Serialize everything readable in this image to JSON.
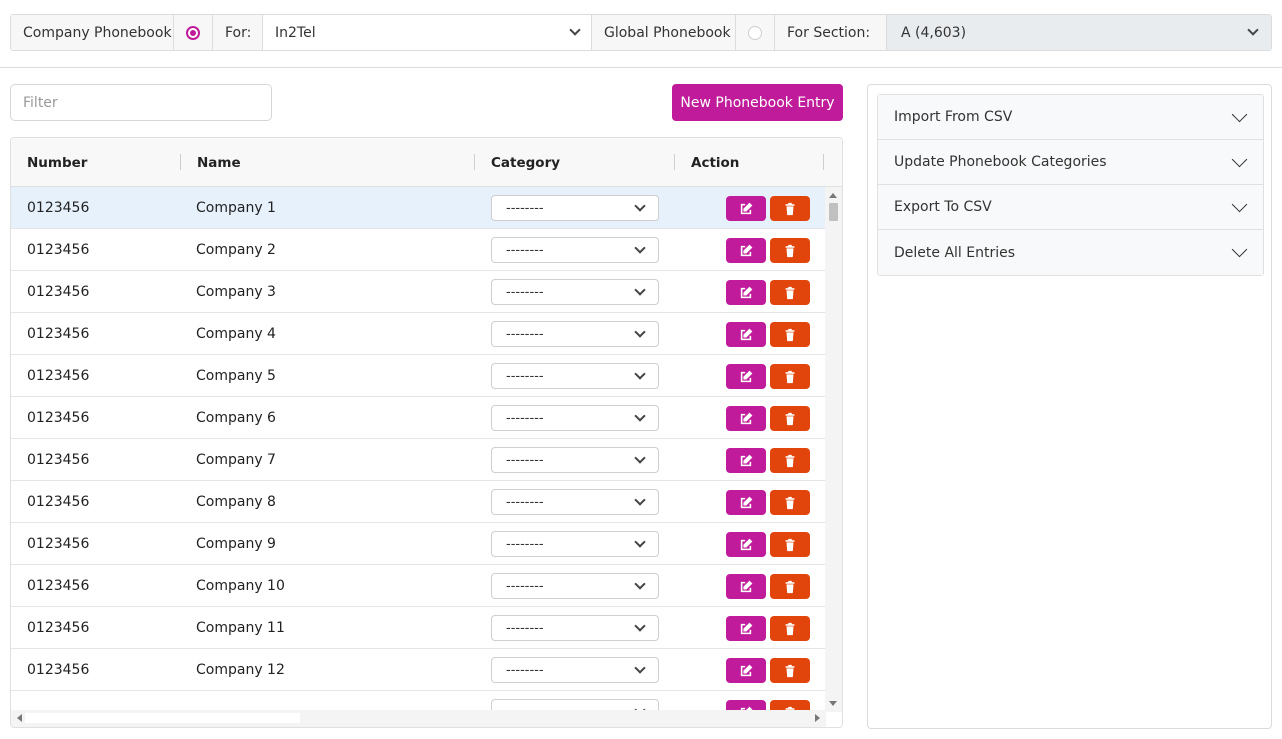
{
  "topbar": {
    "company_phonebook_label": "Company Phonebook",
    "company_phonebook_selected": true,
    "for_label": "For:",
    "for_value": "In2Tel",
    "global_phonebook_label": "Global Phonebook",
    "global_phonebook_selected": false,
    "for_section_label": "For Section:",
    "for_section_value": "A (4,603)"
  },
  "filter": {
    "placeholder": "Filter",
    "value": ""
  },
  "new_entry_button": "New Phonebook Entry",
  "table": {
    "headers": {
      "number": "Number",
      "name": "Name",
      "category": "Category",
      "action": "Action"
    },
    "rows": [
      {
        "number": "0123456",
        "name": "Company 1",
        "category": "--------"
      },
      {
        "number": "0123456",
        "name": "Company 2",
        "category": "--------"
      },
      {
        "number": "0123456",
        "name": "Company 3",
        "category": "--------"
      },
      {
        "number": "0123456",
        "name": "Company 4",
        "category": "--------"
      },
      {
        "number": "0123456",
        "name": "Company 5",
        "category": "--------"
      },
      {
        "number": "0123456",
        "name": "Company 6",
        "category": "--------"
      },
      {
        "number": "0123456",
        "name": "Company 7",
        "category": "--------"
      },
      {
        "number": "0123456",
        "name": "Company 8",
        "category": "--------"
      },
      {
        "number": "0123456",
        "name": "Company 9",
        "category": "--------"
      },
      {
        "number": "0123456",
        "name": "Company 10",
        "category": "--------"
      },
      {
        "number": "0123456",
        "name": "Company 11",
        "category": "--------"
      },
      {
        "number": "0123456",
        "name": "Company 12",
        "category": "--------"
      },
      {
        "number": "",
        "name": "",
        "category": "--------"
      }
    ],
    "selected_row": 0
  },
  "side_panel": {
    "items": [
      {
        "label": "Import From CSV"
      },
      {
        "label": "Update Phonebook Categories"
      },
      {
        "label": "Export To CSV"
      },
      {
        "label": "Delete All Entries"
      }
    ]
  },
  "colors": {
    "primary": "#c01b9a",
    "danger": "#e1450c",
    "selected_row": "#e6f1fb"
  },
  "icons": {
    "edit": "edit-icon",
    "delete": "trash-icon"
  }
}
